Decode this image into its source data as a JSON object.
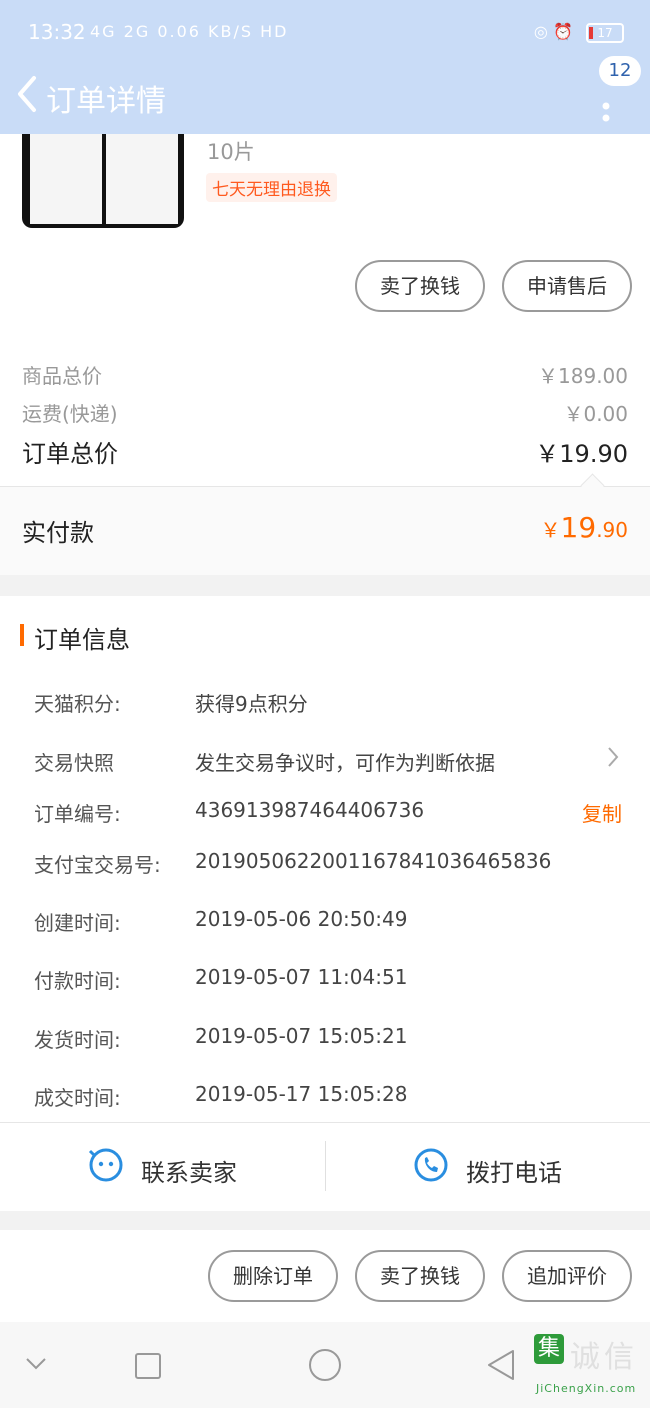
{
  "status": {
    "time": "13:32",
    "net_icons": "4G 2G 0.06 KB/S HD",
    "battery": "17"
  },
  "header": {
    "title": "订单详情",
    "badge": "12"
  },
  "product": {
    "qty": "10片",
    "tag": "七天无理由退换"
  },
  "product_actions": {
    "sell": "卖了换钱",
    "after_sale": "申请售后"
  },
  "prices": {
    "goods_label": "商品总价",
    "goods_value": "￥189.00",
    "shipping_label": "运费(快递)",
    "shipping_value": "￥0.00",
    "total_label": "订单总价",
    "total_value": "￥19.90"
  },
  "paid": {
    "label": "实付款",
    "symbol": "￥",
    "int": "19",
    "dec": ".90"
  },
  "order_info": {
    "title": "订单信息",
    "rows": [
      {
        "label": "天猫积分:",
        "value": "获得9点积分"
      },
      {
        "label": "交易快照",
        "value": "发生交易争议时，可作为判断依据"
      },
      {
        "label": "订单编号:",
        "value": "436913987464406736",
        "action": "复制"
      },
      {
        "label": "支付宝交易号:",
        "value": "2019050622001167841036465836"
      },
      {
        "label": "创建时间:",
        "value": "2019-05-06 20:50:49"
      },
      {
        "label": "付款时间:",
        "value": "2019-05-07 11:04:51"
      },
      {
        "label": "发货时间:",
        "value": "2019-05-07 15:05:21"
      },
      {
        "label": "成交时间:",
        "value": "2019-05-17 15:05:28"
      }
    ]
  },
  "contact": {
    "seller": "联系卖家",
    "phone": "拨打电话"
  },
  "actions": {
    "delete": "删除订单",
    "sell": "卖了换钱",
    "review": "追加评价"
  },
  "watermark": {
    "logo": "集",
    "text": "诚信",
    "site": "JiChengXin.com"
  },
  "colors": {
    "accent": "#ff6a00",
    "header_bg": "#c9dcf7",
    "link_blue": "#2a8ee0"
  }
}
